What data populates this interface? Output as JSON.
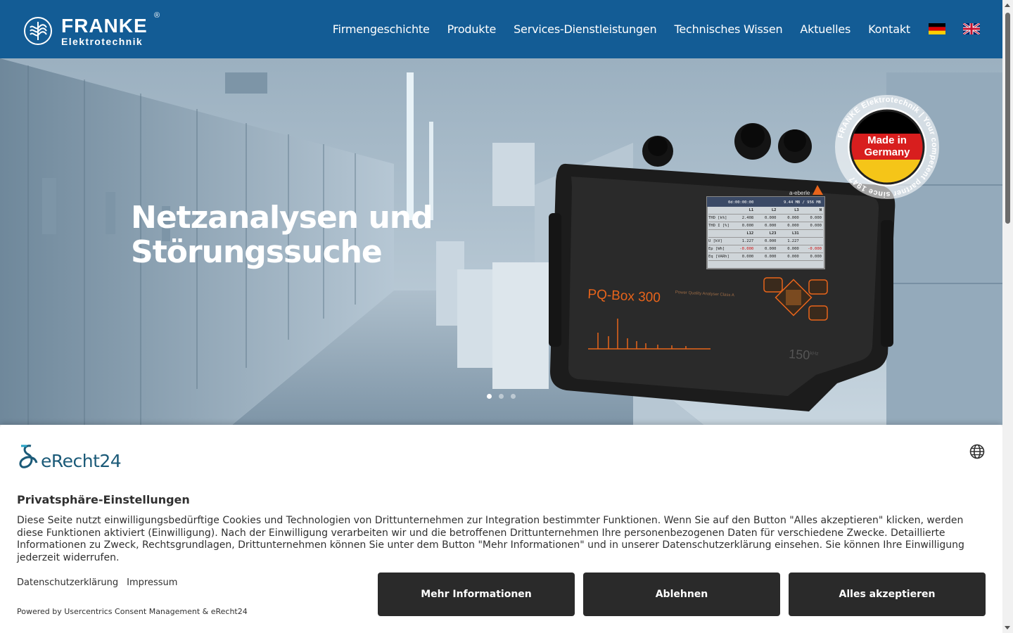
{
  "header": {
    "logo": {
      "name": "FRANKE",
      "sub": "Elektrotechnik",
      "reg": "®"
    },
    "nav": [
      {
        "label": "Firmengeschichte"
      },
      {
        "label": "Produkte"
      },
      {
        "label": "Services-Dienstleistungen"
      },
      {
        "label": "Technisches Wissen"
      },
      {
        "label": "Aktuelles"
      },
      {
        "label": "Kontakt"
      }
    ],
    "languages": [
      "flag-de-icon",
      "flag-uk-icon"
    ]
  },
  "hero": {
    "title_line1": "Netzanalysen und",
    "title_line2": "Störungssuche",
    "device": {
      "brand": "a-eberle",
      "model": "PQ-Box 300",
      "tagline": "Power Quality Analyser Class A",
      "freq": "150",
      "freq_unit": "kHz",
      "screen": {
        "time": "0d:00:00:00",
        "memory": "9.44 MB / 956 MB",
        "head1": [
          "",
          "L1",
          "L2",
          "L3",
          "N"
        ],
        "rows1": [
          [
            "THD [k%]",
            "2.408",
            "0.000",
            "0.000",
            "0.000"
          ],
          [
            "THD I [%]",
            "0.000",
            "0.000",
            "0.000",
            "0.000"
          ]
        ],
        "head2": [
          "",
          "L12",
          "L23",
          "L31",
          ""
        ],
        "rows2": [
          [
            "U [kV]",
            "1.227",
            "0.000",
            "1.227",
            ""
          ],
          [
            "Ep [Wh]",
            "-0.000",
            "0.000",
            "0.000",
            "-0.000"
          ],
          [
            "Eq [VARh]",
            "0.000",
            "0.000",
            "0.000",
            "0.000"
          ]
        ]
      }
    },
    "badge": {
      "text1": "Made in",
      "text2": "Germany",
      "ring": "FRANKE Elektrotechnik | Your competent partner since 1947"
    },
    "slider_dots": 3,
    "active_dot": 0
  },
  "consent": {
    "brand": "eRecht24",
    "title": "Privatsphäre-Einstellungen",
    "text": "Diese Seite nutzt einwilligungsbedürftige Cookies und Technologien von Drittunternehmen zur Integration bestimmter Funktionen. Wenn Sie auf den Button \"Alles akzeptieren\" klicken, werden diese Funktionen aktiviert (Einwilligung). Nach der Einwilligung verarbeiten wir und die betroffenen Drittunternehmen Ihre personenbezogenen Daten für verschiedene Zwecke. Detaillierte Informationen zu Zweck, Rechtsgrundlagen, Drittunternehmen können Sie unter dem Button \"Mehr Informationen\" und in unserer Datenschutzerklärung einsehen. Sie können Ihre Einwilligung jederzeit widerrufen.",
    "link_privacy": "Datenschutzerklärung",
    "link_imprint": "Impressum",
    "powered": "Powered by Usercentrics Consent Management & eRecht24",
    "btn_more": "Mehr Informationen",
    "btn_deny": "Ablehnen",
    "btn_accept": "Alles akzeptieren"
  },
  "colors": {
    "header_bg": "#135c95",
    "button_bg": "#2a2a2a",
    "device_orange": "#e8641b",
    "brand_teal": "#1b5a78"
  }
}
